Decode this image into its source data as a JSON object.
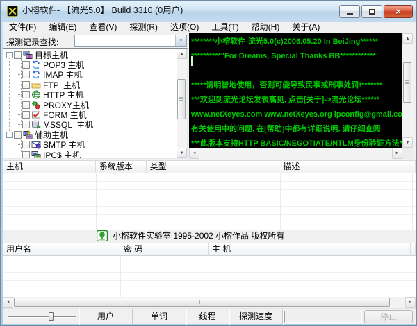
{
  "window": {
    "title": "小榕软件- 【流光5.0】 Build 3310 (0用户)"
  },
  "menu": {
    "items": [
      "文件(F)",
      "编辑(E)",
      "查看(V)",
      "探测(R)",
      "选项(O)",
      "工具(T)",
      "帮助(H)",
      "关于(A)"
    ]
  },
  "finder": {
    "label": "探测记录查找:",
    "value": ""
  },
  "tree": {
    "groups": [
      {
        "label": "目标主机",
        "icon": "target-hosts-icon",
        "items": [
          {
            "label": "POP3 主机",
            "icon": "pop3-sync-icon"
          },
          {
            "label": "IMAP 主机",
            "icon": "imap-sync-icon"
          },
          {
            "label": "FTP  主机",
            "icon": "ftp-folder-icon"
          },
          {
            "label": "HTTP 主机",
            "icon": "http-globe-icon"
          },
          {
            "label": "PROXY主机",
            "icon": "proxy-gears-icon"
          },
          {
            "label": "FORM 主机",
            "icon": "form-check-icon"
          },
          {
            "label": "MSSQL  主机",
            "icon": "mssql-database-icon"
          }
        ]
      },
      {
        "label": "辅助主机",
        "icon": "aux-hosts-icon",
        "items": [
          {
            "label": "SMTP 主机",
            "icon": "smtp-mail-icon"
          },
          {
            "label": "IPC$ 主机",
            "icon": "ipc-computers-icon"
          }
        ]
      }
    ]
  },
  "terminal": {
    "background": "#000000",
    "text_color": "#00c800",
    "lines": [
      "********小榕软件-流光5.0(c)2006.05.20 In BeiJing******",
      "**********\"For Dreams, Special Thanks BB************",
      "",
      "*****请明智地使用，否则可能导致民事或刑事处罚!*******",
      "***欢迎到流光论坛发表高见, 点击[关于]->流光论坛******",
      "www.netXeyes.com www.netXeyes.org ipconfig@gmail.com",
      "有关使用中的问题, 在[帮助]中都有详细说明, 请仔细查阅",
      "***此版本支持HTTP BASIC/NEGOTIATE/NTLM身份验证方法***"
    ]
  },
  "hosts_table": {
    "columns": [
      "主机",
      "系统版本",
      "类型",
      "描述"
    ]
  },
  "copyright": {
    "text": "小榕软件实验室 1995-2002 小榕作品 版权所有"
  },
  "results_table": {
    "columns": [
      "用户名",
      "密 码",
      "主 机"
    ]
  },
  "statusbar": {
    "panes": [
      "用户",
      "单词",
      "线程",
      "探测速度"
    ],
    "stop_label": "停止"
  },
  "icons": {
    "dropdown": "▼",
    "scroll_up": "▲",
    "scroll_down": "▼",
    "scroll_left": "◄",
    "scroll_right": "►",
    "close": "×"
  }
}
